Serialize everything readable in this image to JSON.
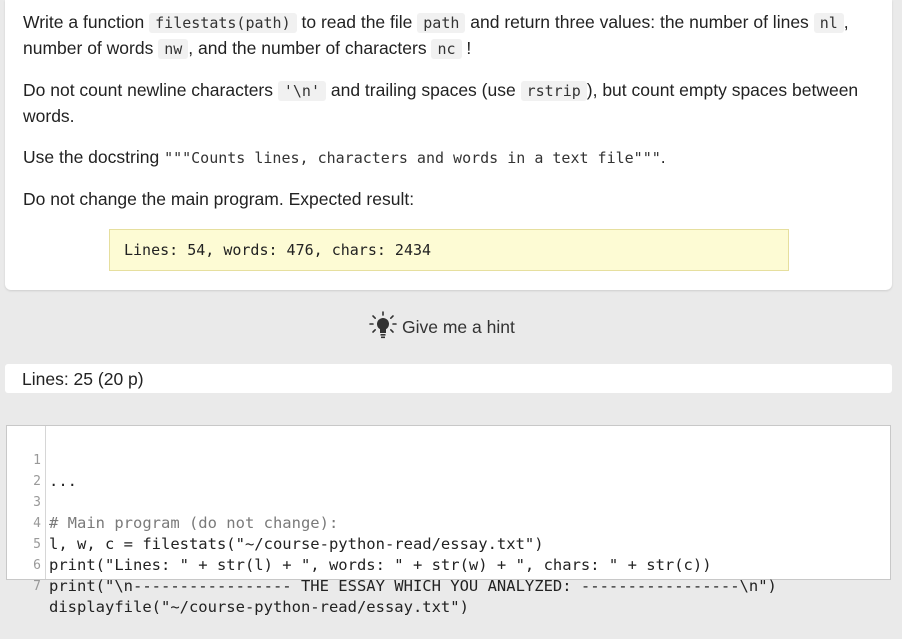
{
  "task": {
    "p1": {
      "a": "Write a function",
      "code_filestats": "filestats(path)",
      "b": "to read the file",
      "code_path": "path",
      "c": "and return three values: the number of lines",
      "code_nl": "nl",
      "d": ", number of words",
      "code_nw": "nw",
      "e": ", and the number of characters",
      "code_nc": "nc",
      "f": "!"
    },
    "p2": {
      "a": "Do not count newline characters",
      "code_newline": "'\\n'",
      "b": "and trailing spaces (use",
      "code_rstrip": "rstrip",
      "c": "), but count empty spaces between words."
    },
    "p3": {
      "a": "Use the docstring",
      "docstring": "\"\"\"Counts lines, characters and words in a text file\"\"\"",
      "b": "."
    },
    "p4": "Do not change the main program. Expected result:",
    "expected_output": "Lines: 54, words: 476, chars: 2434"
  },
  "hint": {
    "label": "Give me a hint",
    "icon": "lightbulb-icon"
  },
  "lines_status": "Lines: 25 (20 p)",
  "editor": {
    "lines": [
      {
        "num": "1",
        "text": "..."
      },
      {
        "num": "2",
        "text": ""
      },
      {
        "num": "3",
        "text": "# Main program (do not change):"
      },
      {
        "num": "4",
        "text": "l, w, c = filestats(\"~/course-python-read/essay.txt\")"
      },
      {
        "num": "5",
        "text": "print(\"Lines: \" + str(l) + \", words: \" + str(w) + \", chars: \" + str(c))"
      },
      {
        "num": "6",
        "text": "print(\"\\n----------------- THE ESSAY WHICH YOU ANALYZED: -----------------\\n\")"
      },
      {
        "num": "7",
        "text": "displayfile(\"~/course-python-read/essay.txt\")"
      }
    ]
  }
}
